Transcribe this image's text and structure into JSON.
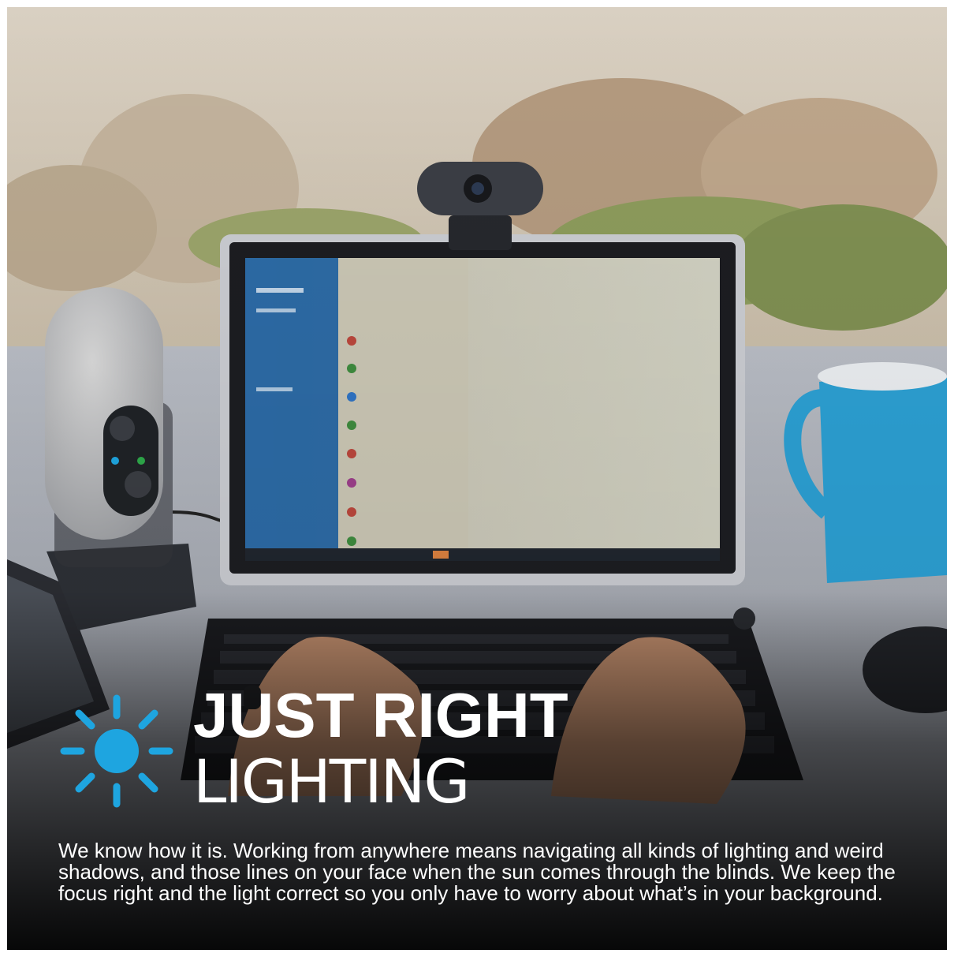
{
  "headline": {
    "line1": "JUST RIGHT",
    "line2": "LIGHTING"
  },
  "body": {
    "text": "We know how it is. Working from anywhere means navigating all kinds of lighting and weird shadows, and those lines on your face when the sun comes through the blinds. We keep the focus right and the light correct so you only have to worry about what’s in your background."
  },
  "icons": {
    "sun": "sun-icon"
  },
  "colors": {
    "accent": "#1ea5e0",
    "text": "#ffffff",
    "mug": "#2c9fd2"
  }
}
